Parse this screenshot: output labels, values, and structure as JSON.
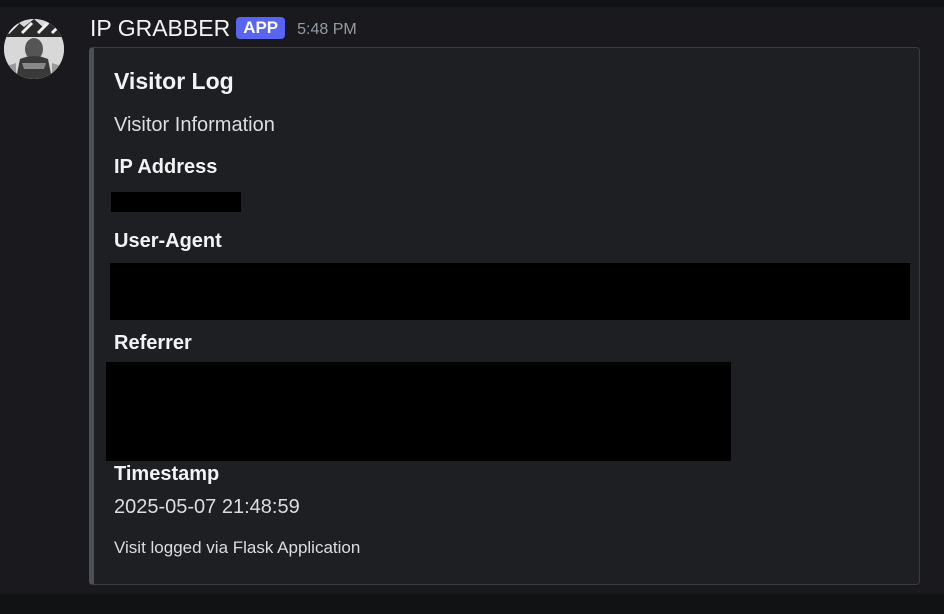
{
  "message": {
    "author": "IP GRABBER",
    "badge": "APP",
    "time": "5:48 PM"
  },
  "embed": {
    "title": "Visitor Log",
    "description": "Visitor Information",
    "fields": [
      {
        "name": "IP Address",
        "value": "[redacted]"
      },
      {
        "name": "User-Agent",
        "value": "[redacted]"
      },
      {
        "name": "Referrer",
        "value": "[redacted]"
      },
      {
        "name": "Timestamp",
        "value": "2025-05-07 21:48:59"
      }
    ],
    "footer": "Visit logged via Flask Application"
  },
  "colors": {
    "background": "#1a1a1e",
    "embed_background": "#1e1f22",
    "embed_border": "#4e5058",
    "badge": "#5865f2",
    "muted_text": "#949ba4"
  },
  "icons": {
    "avatar": "avatar-image"
  }
}
